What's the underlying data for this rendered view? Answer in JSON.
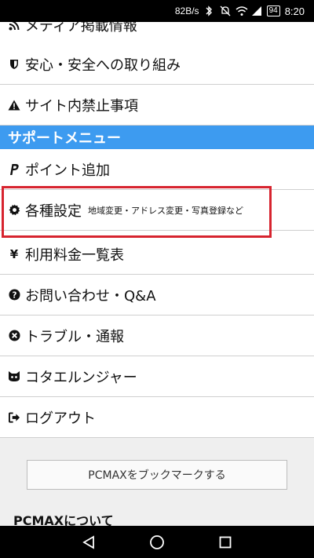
{
  "status_bar": {
    "speed": "82B/s",
    "battery": "94",
    "time": "8:20"
  },
  "menu": {
    "items_top": [
      {
        "label": "メディア掲載情報",
        "icon": "rss-icon"
      },
      {
        "label": "安心・安全への取り組み",
        "icon": "shield-icon"
      },
      {
        "label": "サイト内禁止事項",
        "icon": "warning-icon"
      }
    ],
    "section_title": "サポートメニュー",
    "support_items": [
      {
        "label": "ポイント追加",
        "icon": "paypal-icon"
      },
      {
        "label": "各種設定",
        "sub": "地域変更・アドレス変更・写真登録など",
        "icon": "gear-icon"
      },
      {
        "label": "利用料金一覧表",
        "icon": "yen-icon"
      },
      {
        "label": "お問い合わせ・Q&A",
        "icon": "question-icon"
      },
      {
        "label": "トラブル・通報",
        "icon": "close-circle-icon"
      },
      {
        "label": "コタエルンジャー",
        "icon": "cat-icon"
      },
      {
        "label": "ログアウト",
        "icon": "logout-icon"
      }
    ]
  },
  "footer": {
    "bookmark_label": "PCMAXをブックマークする",
    "about_title": "PCMAXについて"
  },
  "colors": {
    "section_bg": "#3d9bf0",
    "highlight": "#d7242f"
  }
}
